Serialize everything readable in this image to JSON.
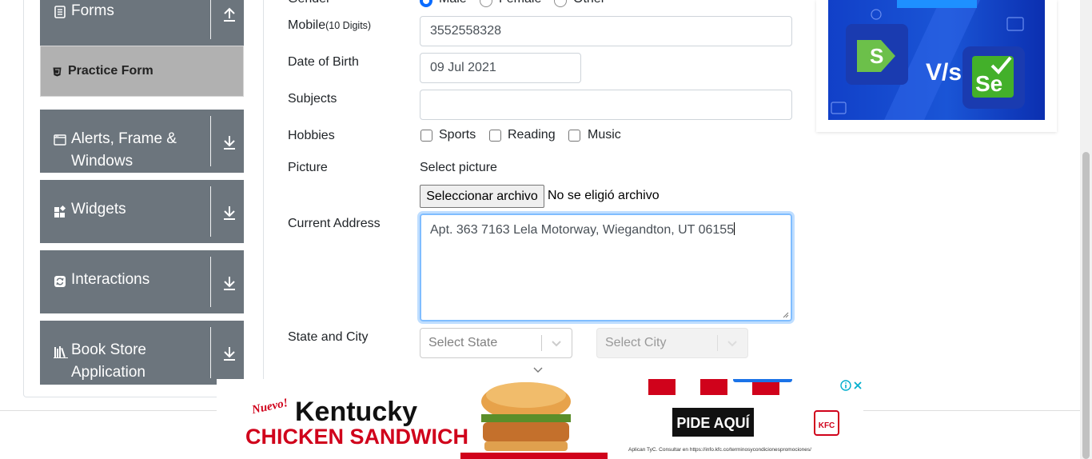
{
  "sidebar": {
    "groups": [
      {
        "label": "Forms",
        "icon": "document-icon",
        "arrow": "up-arrow-icon"
      },
      {
        "label_line1": "Alerts, Frame &",
        "label_line2": "Windows",
        "icon": "window-icon",
        "arrow": "down-arrow-icon"
      },
      {
        "label": "Widgets",
        "icon": "widgets-icon",
        "arrow": "down-arrow-icon"
      },
      {
        "label": "Interactions",
        "icon": "interactions-icon",
        "arrow": "down-arrow-icon"
      },
      {
        "label_line1": "Book Store",
        "label_line2": "Application",
        "icon": "books-icon",
        "arrow": "down-arrow-icon"
      }
    ],
    "active_item": {
      "label": "Practice Form",
      "icon": "html5-icon"
    }
  },
  "form": {
    "gender": {
      "label": "Gender",
      "options": [
        "Male",
        "Female",
        "Other"
      ],
      "selected": "Male"
    },
    "mobile": {
      "label": "Mobile",
      "hint": "(10 Digits)",
      "value": "3552558328"
    },
    "dob": {
      "label": "Date of Birth",
      "value": "09 Jul 2021"
    },
    "subjects": {
      "label": "Subjects",
      "value": ""
    },
    "hobbies": {
      "label": "Hobbies",
      "options": [
        "Sports",
        "Reading",
        "Music"
      ]
    },
    "picture": {
      "label": "Picture",
      "select_text": "Select picture",
      "button": "Seleccionar archivo",
      "status": "No se eligió archivo"
    },
    "address": {
      "label": "Current Address",
      "value": "Apt. 363 7163 Lela Motorway, Wiegandton, UT 06155"
    },
    "state_city": {
      "label": "State and City",
      "state_placeholder": "Select State",
      "city_placeholder": "Select City"
    }
  },
  "ads": {
    "top": {
      "text_vs": "V/s",
      "logo_right": "Se"
    },
    "bottom": {
      "badge": "Nuevo!",
      "title": "Kentucky",
      "subtitle": "CHICKEN SANDWICH",
      "cta": "PIDE AQUÍ",
      "brand": "KFC",
      "fine_print": "Aplican TyC. Consultar en https://info.kfc.co/terminosycondicionespromociones/"
    }
  },
  "colors": {
    "sidebar_bg": "#6c757d",
    "active_bg": "#b1b1b1",
    "focus_border": "#80bdff",
    "radio_checked": "#0a6cff",
    "ad_red": "#d0021b"
  }
}
